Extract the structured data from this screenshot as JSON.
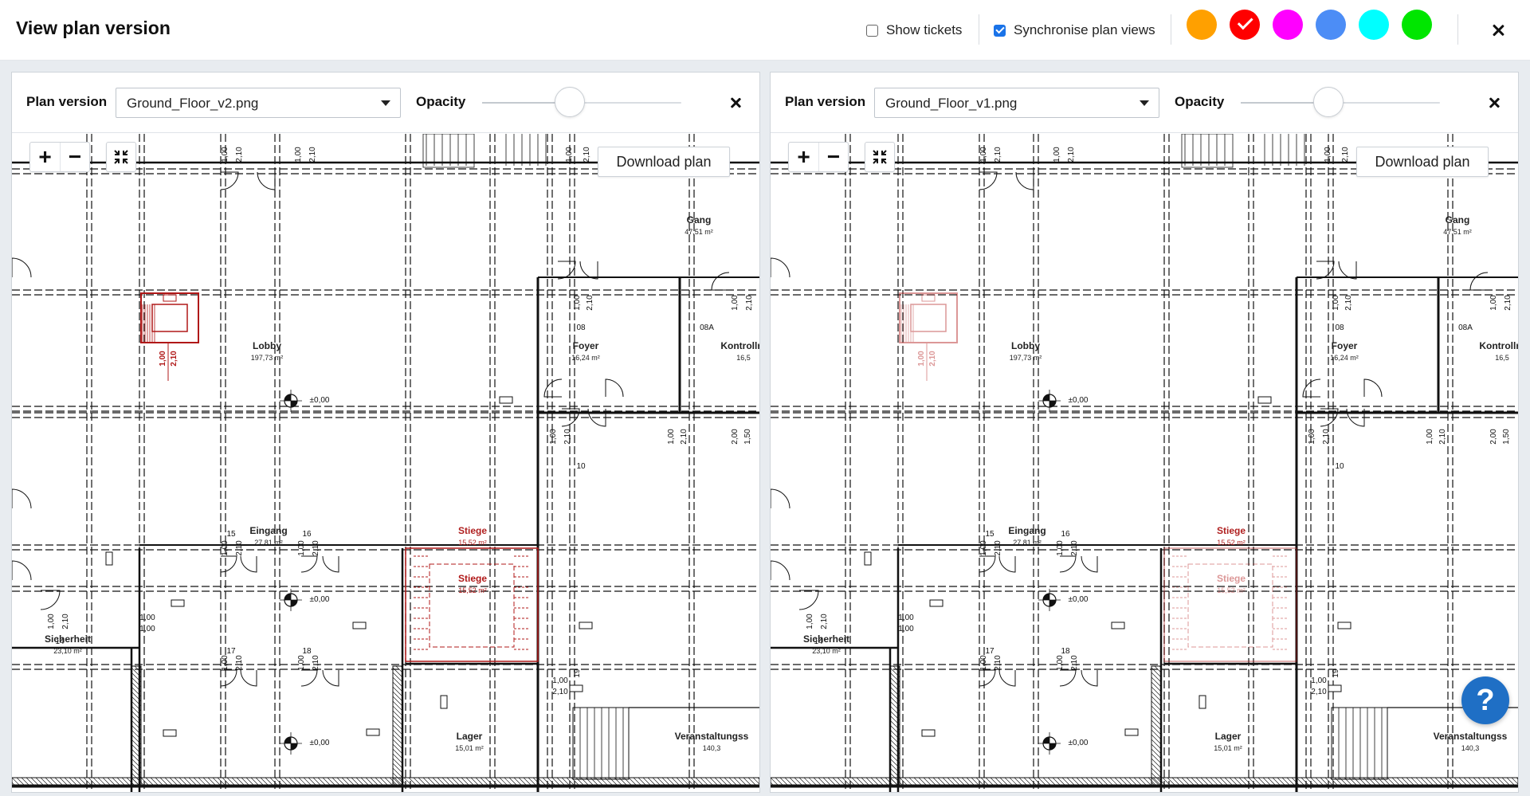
{
  "window": {
    "title": "View plan version",
    "show_tickets_label": "Show tickets",
    "show_tickets_checked": false,
    "sync_label": "Synchronise plan views",
    "sync_checked": true,
    "color_swatches": [
      {
        "name": "orange",
        "color": "#FFA000",
        "selected": false
      },
      {
        "name": "red",
        "color": "#FF0000",
        "selected": true
      },
      {
        "name": "magenta",
        "color": "#FF00FF",
        "selected": false
      },
      {
        "name": "blue",
        "color": "#4C8DF6",
        "selected": false
      },
      {
        "name": "cyan",
        "color": "#00FFFF",
        "selected": false
      },
      {
        "name": "green",
        "color": "#00E600",
        "selected": false
      }
    ]
  },
  "panels": [
    {
      "plan_version_label": "Plan version",
      "selected_plan": "Ground_Floor_v2.png",
      "opacity_label": "Opacity",
      "opacity_value": 0.5,
      "download_label": "Download plan",
      "overlay_opacity": 1.0
    },
    {
      "plan_version_label": "Plan version",
      "selected_plan": "Ground_Floor_v1.png",
      "opacity_label": "Opacity",
      "opacity_value": 0.5,
      "download_label": "Download plan",
      "overlay_opacity": 0.45
    }
  ],
  "floorplan": {
    "rooms": [
      {
        "name": "Lobby",
        "area": "197,73 m²"
      },
      {
        "name": "Foyer",
        "area": "16,24 m²"
      },
      {
        "name": "Kontrollra",
        "area": "16,5"
      },
      {
        "name": "Gang",
        "area": "47,51 m²"
      },
      {
        "name": "Eingang",
        "area": "27,81 m²"
      },
      {
        "name": "Stiege",
        "area": "15,52 m²"
      },
      {
        "name": "Sicherheit",
        "area": "23,10 m²"
      },
      {
        "name": "Lager",
        "area": "15,01 m²"
      },
      {
        "name": "Veranstaltungss",
        "area": "140,3"
      }
    ],
    "door_numbers": [
      "08",
      "08A",
      "10",
      "15",
      "16",
      "14",
      "17",
      "18",
      "19"
    ],
    "dimensions": [
      "1,00",
      "2,10",
      "2,00",
      "1,50"
    ],
    "level_marks": [
      "±0,00"
    ]
  },
  "help": {
    "label": "?"
  }
}
